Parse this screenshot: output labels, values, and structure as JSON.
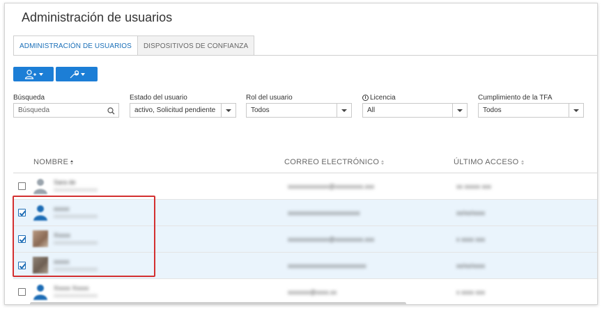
{
  "page": {
    "title": "Administración de usuarios"
  },
  "tabs": [
    {
      "label": "ADMINISTRACIÓN DE USUARIOS",
      "active": true
    },
    {
      "label": "DISPOSITIVOS DE CONFIANZA",
      "active": false
    }
  ],
  "toolbar": {
    "add_user_icon": "add-user-icon",
    "tools_icon": "wrench-icon",
    "accent": "#1c7ed6"
  },
  "filters": {
    "search": {
      "label": "Búsqueda",
      "placeholder": "Búsqueda"
    },
    "status": {
      "label": "Estado del usuario",
      "value": "activo, Solicitud pendiente"
    },
    "role": {
      "label": "Rol del usuario",
      "value": "Todos"
    },
    "license": {
      "label": "Licencia",
      "value": "All"
    },
    "tfa": {
      "label": "Cumplimiento de la TFA",
      "value": "Todos"
    }
  },
  "table": {
    "columns": [
      "NOMBRE",
      "CORREO ELECTRÓNICO",
      "ÚLTIMO ACCESO"
    ],
    "rows": [
      {
        "name": "Sara de",
        "sub": "xxxxxxxxxxxxxxxxxx",
        "email": "xxxxxxxxxxxxx@xxxxxxxxx.xxx",
        "last": "xx xxxxx xxx",
        "checked": false,
        "avatar": "default"
      },
      {
        "name": "xxxxx",
        "sub": "xxxxxxxxxxxxxxxxxx",
        "email": "xxxxxxxxxxxxxxxxxxxxxxx",
        "last": "xx/xx/xxxx",
        "checked": true,
        "avatar": "default"
      },
      {
        "name": "Xxxxx",
        "sub": "xxxxxxxxxxxxxxxxxx",
        "email": "xxxxxxxxxxxxx@xxxxxxxxx.xxx",
        "last": "x xxxx xxx",
        "checked": true,
        "avatar": "photo-a"
      },
      {
        "name": "xxxxx",
        "sub": "xxxxxxxxxxxxxxxxxx",
        "email": "xxxxxxxxxxxxxxxxxxxxxxxxx",
        "last": "xx/xx/xxxx",
        "checked": true,
        "avatar": "photo-b"
      },
      {
        "name": "Xxxxx Xxxxx",
        "sub": "xxxxxxxxxxxxxxxxxx",
        "email": "xxxxxxx@xxxx.xx",
        "last": "x xxxx xxx",
        "checked": false,
        "avatar": "default"
      }
    ]
  },
  "colors": {
    "selected_row": "#eaf4fc",
    "highlight_box": "#d32f2f",
    "tab_active": "#1a6fb8"
  }
}
